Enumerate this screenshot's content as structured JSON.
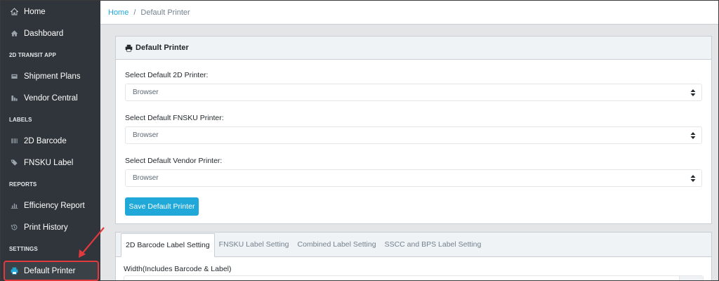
{
  "sidebar": {
    "items": [
      {
        "type": "item",
        "label": "Home",
        "icon": "home-icon"
      },
      {
        "type": "item",
        "label": "Dashboard",
        "icon": "dashboard-icon"
      },
      {
        "type": "title",
        "label": "2D TRANSIT APP"
      },
      {
        "type": "item",
        "label": "Shipment Plans",
        "icon": "truck-icon"
      },
      {
        "type": "item",
        "label": "Vendor Central",
        "icon": "building-icon"
      },
      {
        "type": "title",
        "label": "LABELS"
      },
      {
        "type": "item",
        "label": "2D Barcode",
        "icon": "barcode-icon"
      },
      {
        "type": "item",
        "label": "FNSKU Label",
        "icon": "tags-icon"
      },
      {
        "type": "title",
        "label": "REPORTS"
      },
      {
        "type": "item",
        "label": "Efficiency Report",
        "icon": "bar-chart-icon"
      },
      {
        "type": "item",
        "label": "Print History",
        "icon": "history-icon"
      },
      {
        "type": "title",
        "label": "SETTINGS"
      },
      {
        "type": "item",
        "label": "Default Printer",
        "icon": "printer-icon",
        "active": true
      }
    ]
  },
  "breadcrumb": {
    "home": "Home",
    "separator": "/",
    "current": "Default Printer"
  },
  "printer_card": {
    "title": "Default Printer",
    "fields": [
      {
        "label": "Select Default 2D Printer:",
        "value": "Browser"
      },
      {
        "label": "Select Default FNSKU Printer:",
        "value": "Browser"
      },
      {
        "label": "Select Default Vendor Printer:",
        "value": "Browser"
      }
    ],
    "save_label": "Save Default Printer"
  },
  "settings_card": {
    "tabs": [
      {
        "label": "2D Barcode Label Setting",
        "active": true
      },
      {
        "label": "FNSKU Label Setting"
      },
      {
        "label": "Combined Label Setting"
      },
      {
        "label": "SSCC and BPS Label Setting"
      }
    ],
    "width_label": "Width(Includes Barcode & Label)"
  },
  "colors": {
    "sidebar_bg": "#2f353a",
    "accent": "#20a8d8",
    "highlight_border": "#e0393e"
  }
}
